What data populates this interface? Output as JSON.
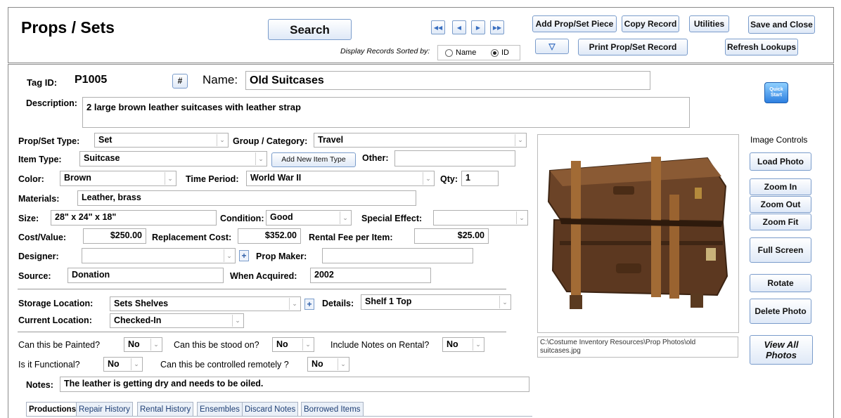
{
  "header": {
    "title": "Props / Sets",
    "search_label": "Search",
    "sort_label": "Display Records Sorted by:",
    "sort_options": [
      "Name",
      "ID"
    ],
    "sort_selected": "ID",
    "add_piece_label": "Add Prop/Set Piece",
    "copy_record_label": "Copy Record",
    "utilities_label": "Utilities",
    "save_close_label": "Save and Close",
    "print_label": "Print Prop/Set Record",
    "refresh_label": "Refresh Lookups"
  },
  "record": {
    "tag_id_label": "Tag ID:",
    "tag_id": "P1005",
    "hash_label": "#",
    "name_label": "Name:",
    "name": "Old Suitcases",
    "description_label": "Description:",
    "description": "2 large brown leather suitcases with leather strap",
    "quick_start_label": "Quick Start",
    "type_label": "Prop/Set Type:",
    "type": "Set",
    "group_label": "Group / Category:",
    "group": "Travel",
    "item_type_label": "Item Type:",
    "item_type": "Suitcase",
    "add_item_type_label": "Add New Item Type",
    "other_label": "Other:",
    "other": "",
    "color_label": "Color:",
    "color": "Brown",
    "time_period_label": "Time Period:",
    "time_period": "World War II",
    "qty_label": "Qty:",
    "qty": "1",
    "materials_label": "Materials:",
    "materials": "Leather, brass",
    "size_label": "Size:",
    "size": "28\" x 24\" x 18\"",
    "condition_label": "Condition:",
    "condition": "Good",
    "special_effect_label": "Special Effect:",
    "special_effect": "",
    "cost_label": "Cost/Value:",
    "cost": "$250.00",
    "replacement_label": "Replacement Cost:",
    "replacement": "$352.00",
    "rental_fee_label": "Rental Fee per Item:",
    "rental_fee": "$25.00",
    "designer_label": "Designer:",
    "designer": "",
    "prop_maker_label": "Prop Maker:",
    "prop_maker": "",
    "source_label": "Source:",
    "source": "Donation",
    "acquired_label": "When Acquired:",
    "acquired": "2002",
    "storage_label": "Storage Location:",
    "storage": "Sets Shelves",
    "details_label": "Details:",
    "details": "Shelf 1 Top",
    "current_location_label": "Current Location:",
    "current_location": "Checked-In",
    "painted_label": "Can this be Painted?",
    "painted": "No",
    "stood_label": "Can this be stood on?",
    "stood": "No",
    "notes_rental_label": "Include Notes on Rental?",
    "notes_rental": "No",
    "functional_label": "Is it Functional?",
    "functional": "No",
    "remote_label": "Can this be controlled remotely ?",
    "remote": "No",
    "notes_label": "Notes:",
    "notes": "The leather is getting dry and needs to be oiled."
  },
  "photo": {
    "path": "C:\\Costume Inventory Resources\\Prop Photos\\old suitcases.jpg"
  },
  "image_controls": {
    "title": "Image Controls",
    "load": "Load Photo",
    "zoom_in": "Zoom In",
    "zoom_out": "Zoom Out",
    "zoom_fit": "Zoom Fit",
    "full_screen": "Full Screen",
    "rotate": "Rotate",
    "delete": "Delete Photo",
    "view_all": "View All Photos"
  },
  "tabs": [
    "Productions",
    "Repair History",
    "Rental History",
    "Ensembles",
    "Discard Notes",
    "Borrowed Items"
  ],
  "colors": {
    "button_border": "#7a9ccb",
    "button_fill": "#dfe9f7",
    "tab_bg": "#eaf0f8"
  }
}
